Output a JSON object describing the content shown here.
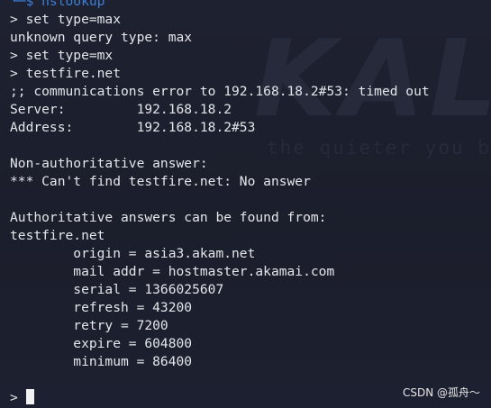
{
  "watermark": {
    "logo": "KALI",
    "tagline": "the quieter you become"
  },
  "terminal": {
    "prompt_line": "└─$ nslookup",
    "lines": [
      "> set type=max",
      "unknown query type: max",
      "> set type=mx",
      "> testfire.net",
      ";; communications error to 192.168.18.2#53: timed out",
      "Server:         192.168.18.2",
      "Address:        192.168.18.2#53",
      "",
      "Non-authoritative answer:",
      "*** Can't find testfire.net: No answer",
      "",
      "Authoritative answers can be found from:",
      "testfire.net",
      "        origin = asia3.akam.net",
      "        mail addr = hostmaster.akamai.com",
      "        serial = 1366025607",
      "        refresh = 43200",
      "        retry = 7200",
      "        expire = 604800",
      "        minimum = 86400"
    ],
    "final_prompt": "> "
  },
  "credit": "CSDN @孤舟～"
}
